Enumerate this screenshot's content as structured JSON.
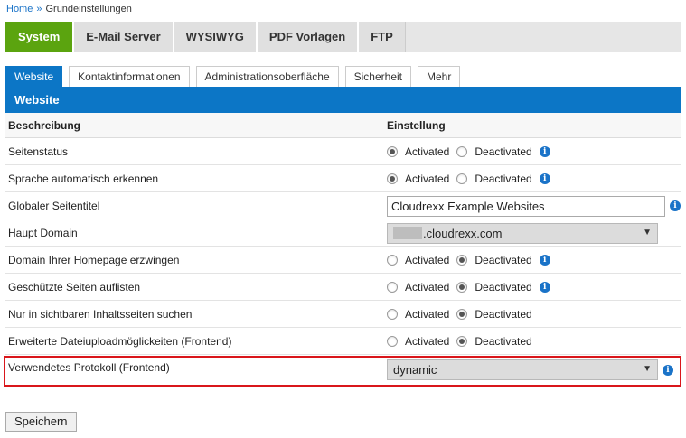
{
  "breadcrumb": {
    "home": "Home",
    "separator": "»",
    "current": "Grundeinstellungen"
  },
  "main_tabs": [
    "System",
    "E-Mail Server",
    "WYSIWYG",
    "PDF Vorlagen",
    "FTP"
  ],
  "sub_tabs": [
    "Website",
    "Kontaktinformationen",
    "Administrationsoberfläche",
    "Sicherheit",
    "Mehr"
  ],
  "section_title": "Website",
  "table": {
    "col_description": "Beschreibung",
    "col_setting": "Einstellung",
    "radio_on": "Activated",
    "radio_off": "Deactivated",
    "rows": [
      {
        "label": "Seitenstatus",
        "value": "Activated"
      },
      {
        "label": "Sprache automatisch erkennen",
        "value": "Activated"
      },
      {
        "label": "Globaler Seitentitel",
        "value": "Cloudrexx Example Websites"
      },
      {
        "label": "Haupt Domain",
        "value": ".cloudrexx.com"
      },
      {
        "label": "Domain Ihrer Homepage erzwingen",
        "value": "Deactivated"
      },
      {
        "label": "Geschützte Seiten auflisten",
        "value": "Deactivated"
      },
      {
        "label": "Nur in sichtbaren Inhaltsseiten suchen",
        "value": "Deactivated"
      },
      {
        "label": "Erweiterte Dateiuploadmöglickeiten (Frontend)",
        "value": "Deactivated"
      },
      {
        "label": "Verwendetes Protokoll (Frontend)",
        "value": "dynamic"
      }
    ]
  },
  "save_label": "Speichern",
  "icons": {
    "info": "info-icon",
    "dropdown": "chevron-down-icon"
  },
  "colors": {
    "primary": "#0c76c6",
    "active_tab": "#5ba40f",
    "highlight": "#d9161b"
  }
}
